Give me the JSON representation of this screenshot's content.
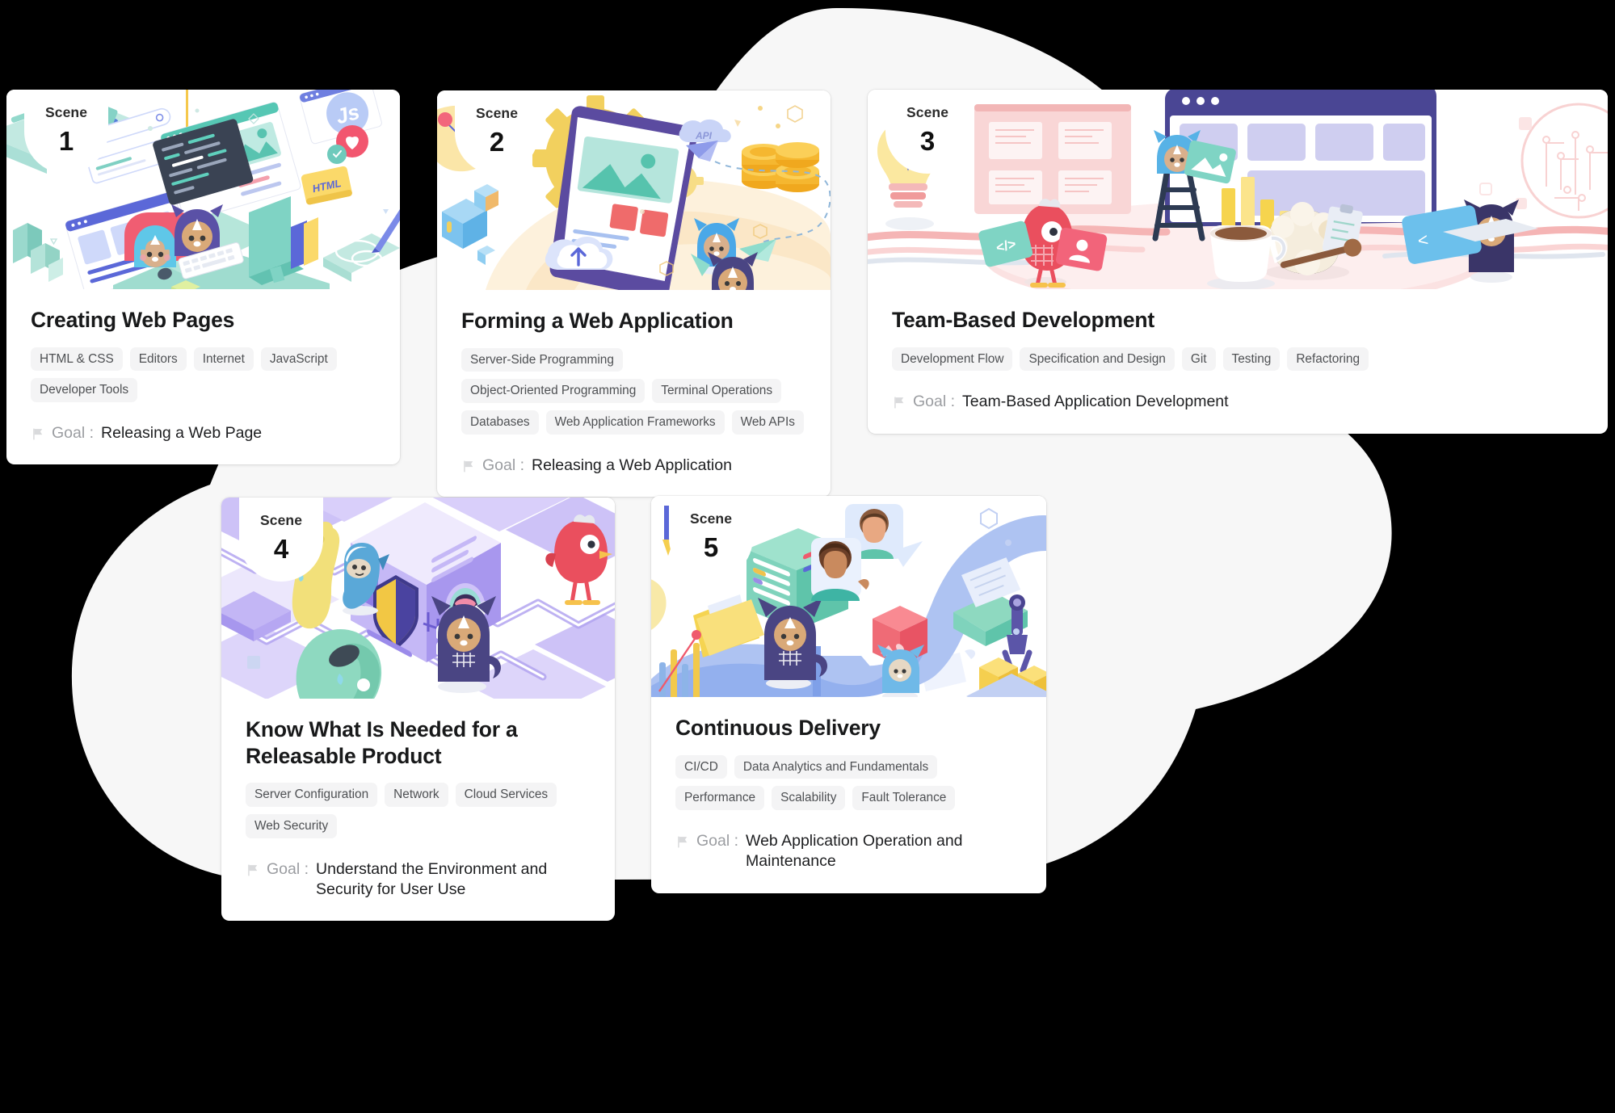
{
  "theme": {
    "page_background": "#000000",
    "blob_color": "#f7f7f7",
    "card_background": "#ffffff",
    "tag_background": "#f4f4f5",
    "tag_text": "#4e5053",
    "title_color": "#18191a",
    "goal_label_color": "#9b9da1",
    "goal_text_color": "#1d1e20"
  },
  "icons": {
    "goal_flag": "flag-icon",
    "scene_badge": "scene-badge"
  },
  "labels": {
    "scene_word": "Scene",
    "goal_label": "Goal :"
  },
  "cards": [
    {
      "scene_word": "Scene",
      "scene_number": "1",
      "title": "Creating Web Pages",
      "tags": [
        "HTML & CSS",
        "Editors",
        "Internet",
        "JavaScript",
        "Developer Tools"
      ],
      "goal_label": "Goal :",
      "goal": "Releasing a Web Page",
      "illustration": "desk-workstation-coding-scene"
    },
    {
      "scene_word": "Scene",
      "scene_number": "2",
      "title": "Forming a Web Application",
      "tags": [
        "Server-Side Programming",
        "Object-Oriented Programming",
        "Terminal Operations",
        "Databases",
        "Web Application Frameworks",
        "Web APIs"
      ],
      "goal_label": "Goal :",
      "goal": "Releasing a Web Application",
      "illustration": "gear-browser-cloud-api-scene"
    },
    {
      "scene_word": "Scene",
      "scene_number": "3",
      "title": "Team-Based Development",
      "tags": [
        "Development Flow",
        "Specification and Design",
        "Git",
        "Testing",
        "Refactoring"
      ],
      "goal_label": "Goal :",
      "goal": "Team-Based Application Development",
      "illustration": "team-whiteboard-kanban-scene"
    },
    {
      "scene_word": "Scene",
      "scene_number": "4",
      "title": "Know What Is Needed for a Releasable Product",
      "tags": [
        "Server Configuration",
        "Network",
        "Cloud Services",
        "Web Security"
      ],
      "goal_label": "Goal :",
      "goal": "Understand the Environment and Security for User Use",
      "illustration": "security-shield-server-cube-scene"
    },
    {
      "scene_word": "Scene",
      "scene_number": "5",
      "title": "Continuous Delivery",
      "tags": [
        "CI/CD",
        "Data Analytics and Fundamentals",
        "Performance",
        "Scalability",
        "Fault Tolerance"
      ],
      "goal_label": "Goal :",
      "goal": "Web Application Operation and Maintenance",
      "illustration": "delivery-pipeline-river-scene"
    }
  ]
}
